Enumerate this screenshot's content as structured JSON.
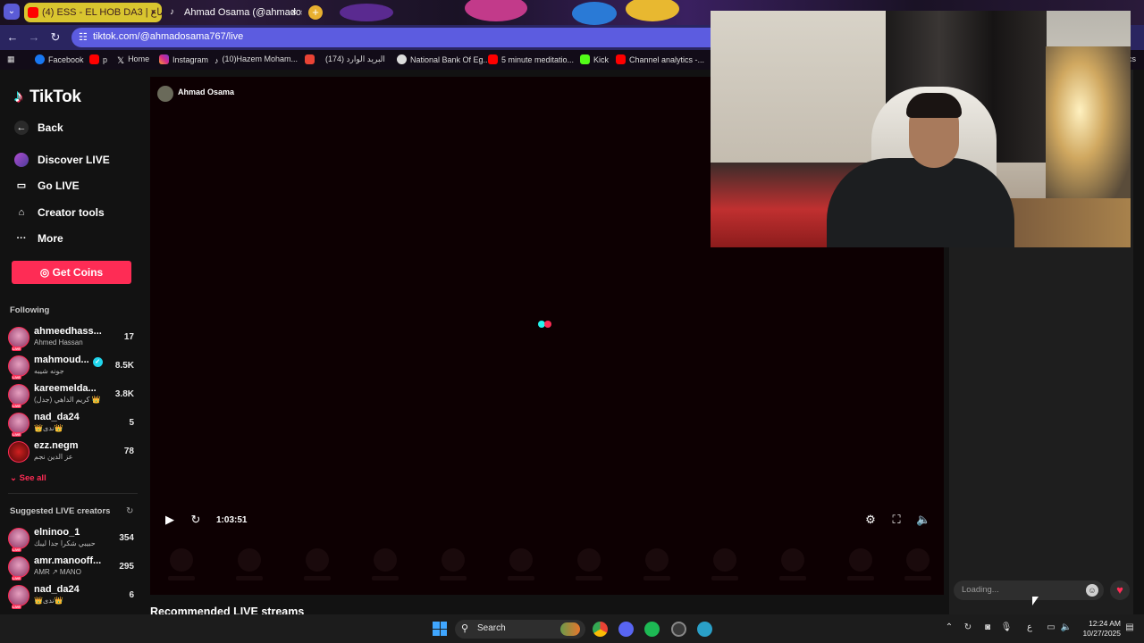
{
  "browser": {
    "tabs": [
      {
        "label": "(4) ESS - EL HOB DA3 | حب ضاع",
        "close": "×"
      },
      {
        "label": "Ahmad Osama (@ahmados",
        "close": "×"
      }
    ],
    "new_tab": "+",
    "url": "tiktok.com/@ahmadosama767/live",
    "bookmarks": [
      "Facebook",
      "p",
      "Home",
      "Instagram",
      "(10)Hazem Moham...",
      "",
      "(174) البريد الوارد",
      "National Bank Of Eg...",
      "5 minute meditatio...",
      "Kick",
      "Channel analytics -..."
    ],
    "bookmark_tail": "cs"
  },
  "sidebar": {
    "logo": "TikTok",
    "nav": [
      {
        "label": "Back",
        "icon": "back-arrow-icon"
      },
      {
        "label": "Discover LIVE",
        "icon": "discover-live-icon"
      },
      {
        "label": "Go LIVE",
        "icon": "camera-icon"
      },
      {
        "label": "Creator tools",
        "icon": "creator-tools-icon"
      },
      {
        "label": "More",
        "icon": "more-dots-icon"
      }
    ],
    "get_coins": "Get Coins",
    "following_title": "Following",
    "following": [
      {
        "name": "ahmeedhass...",
        "sub": "Ahmed Hassan",
        "count": "17",
        "verified": false
      },
      {
        "name": "mahmoud...",
        "sub": "جونه شيبه",
        "count": "8.5K",
        "verified": true
      },
      {
        "name": "kareemelda...",
        "sub": "كريم الداهي (جدل) 👑",
        "count": "3.8K",
        "verified": false
      },
      {
        "name": "nad_da24",
        "sub": "👑ندى👑",
        "count": "5",
        "verified": false
      },
      {
        "name": "ezz.negm",
        "sub": "عز الدين نجم",
        "count": "78",
        "verified": false
      }
    ],
    "see_all": "See all",
    "suggested_title": "Suggested LIVE creators",
    "suggested": [
      {
        "name": "elninoo_1",
        "sub": "حبيبي شكرا جدا ليبك",
        "count": "354"
      },
      {
        "name": "amr.manooff...",
        "sub": "AMR ↗ MANO",
        "count": "295"
      },
      {
        "name": "nad_da24",
        "sub": "👑ندى👑",
        "count": "6"
      }
    ],
    "live_badge": "LIVE"
  },
  "player": {
    "host_name": "Ahmad Osama",
    "duration": "1:03:51",
    "recommended_title": "Recommended LIVE streams"
  },
  "chat": {
    "placeholder": "Loading..."
  },
  "taskbar": {
    "search": "Search",
    "time": "12:24 AM",
    "date": "10/27/2025",
    "lang": "ع"
  }
}
